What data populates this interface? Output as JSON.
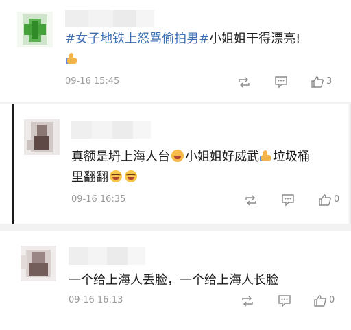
{
  "comments": [
    {
      "topic": "#女子地铁上怒骂偷拍男#",
      "text": "小姐姐干得漂亮!",
      "emoji": "thumbs-up-emoji",
      "time": "09-16 15:45",
      "like_count": "3",
      "avatar_colors": [
        "#f3f8f1",
        "#9dc797",
        "#45a23a",
        "#e8f2e5"
      ]
    },
    {
      "text_a": "真额是坍上海人台",
      "text_b": "小姐姐好威武",
      "text_c": "垃圾桶",
      "text_line2": "里翻翻",
      "emojis": [
        "angry-face-emoji",
        "thumbs-up-emoji",
        "laugh-emoji",
        "laugh-emoji"
      ],
      "time": "09-16 16:35",
      "like_count": "0",
      "avatar_colors": [
        "#e5e2e0",
        "#a89f9c",
        "#6a5552",
        "#d7cfcc"
      ]
    },
    {
      "text": "一个给上海人丢脸，一个给上海人长脸",
      "time": "09-16 16:13",
      "like_count": "0",
      "avatar_colors": [
        "#ebe7e6",
        "#b8aaa8",
        "#7a6360",
        "#dcd3d1"
      ]
    }
  ],
  "icons": {
    "repost": "repost-icon",
    "comment": "comment-icon",
    "like": "like-icon"
  }
}
